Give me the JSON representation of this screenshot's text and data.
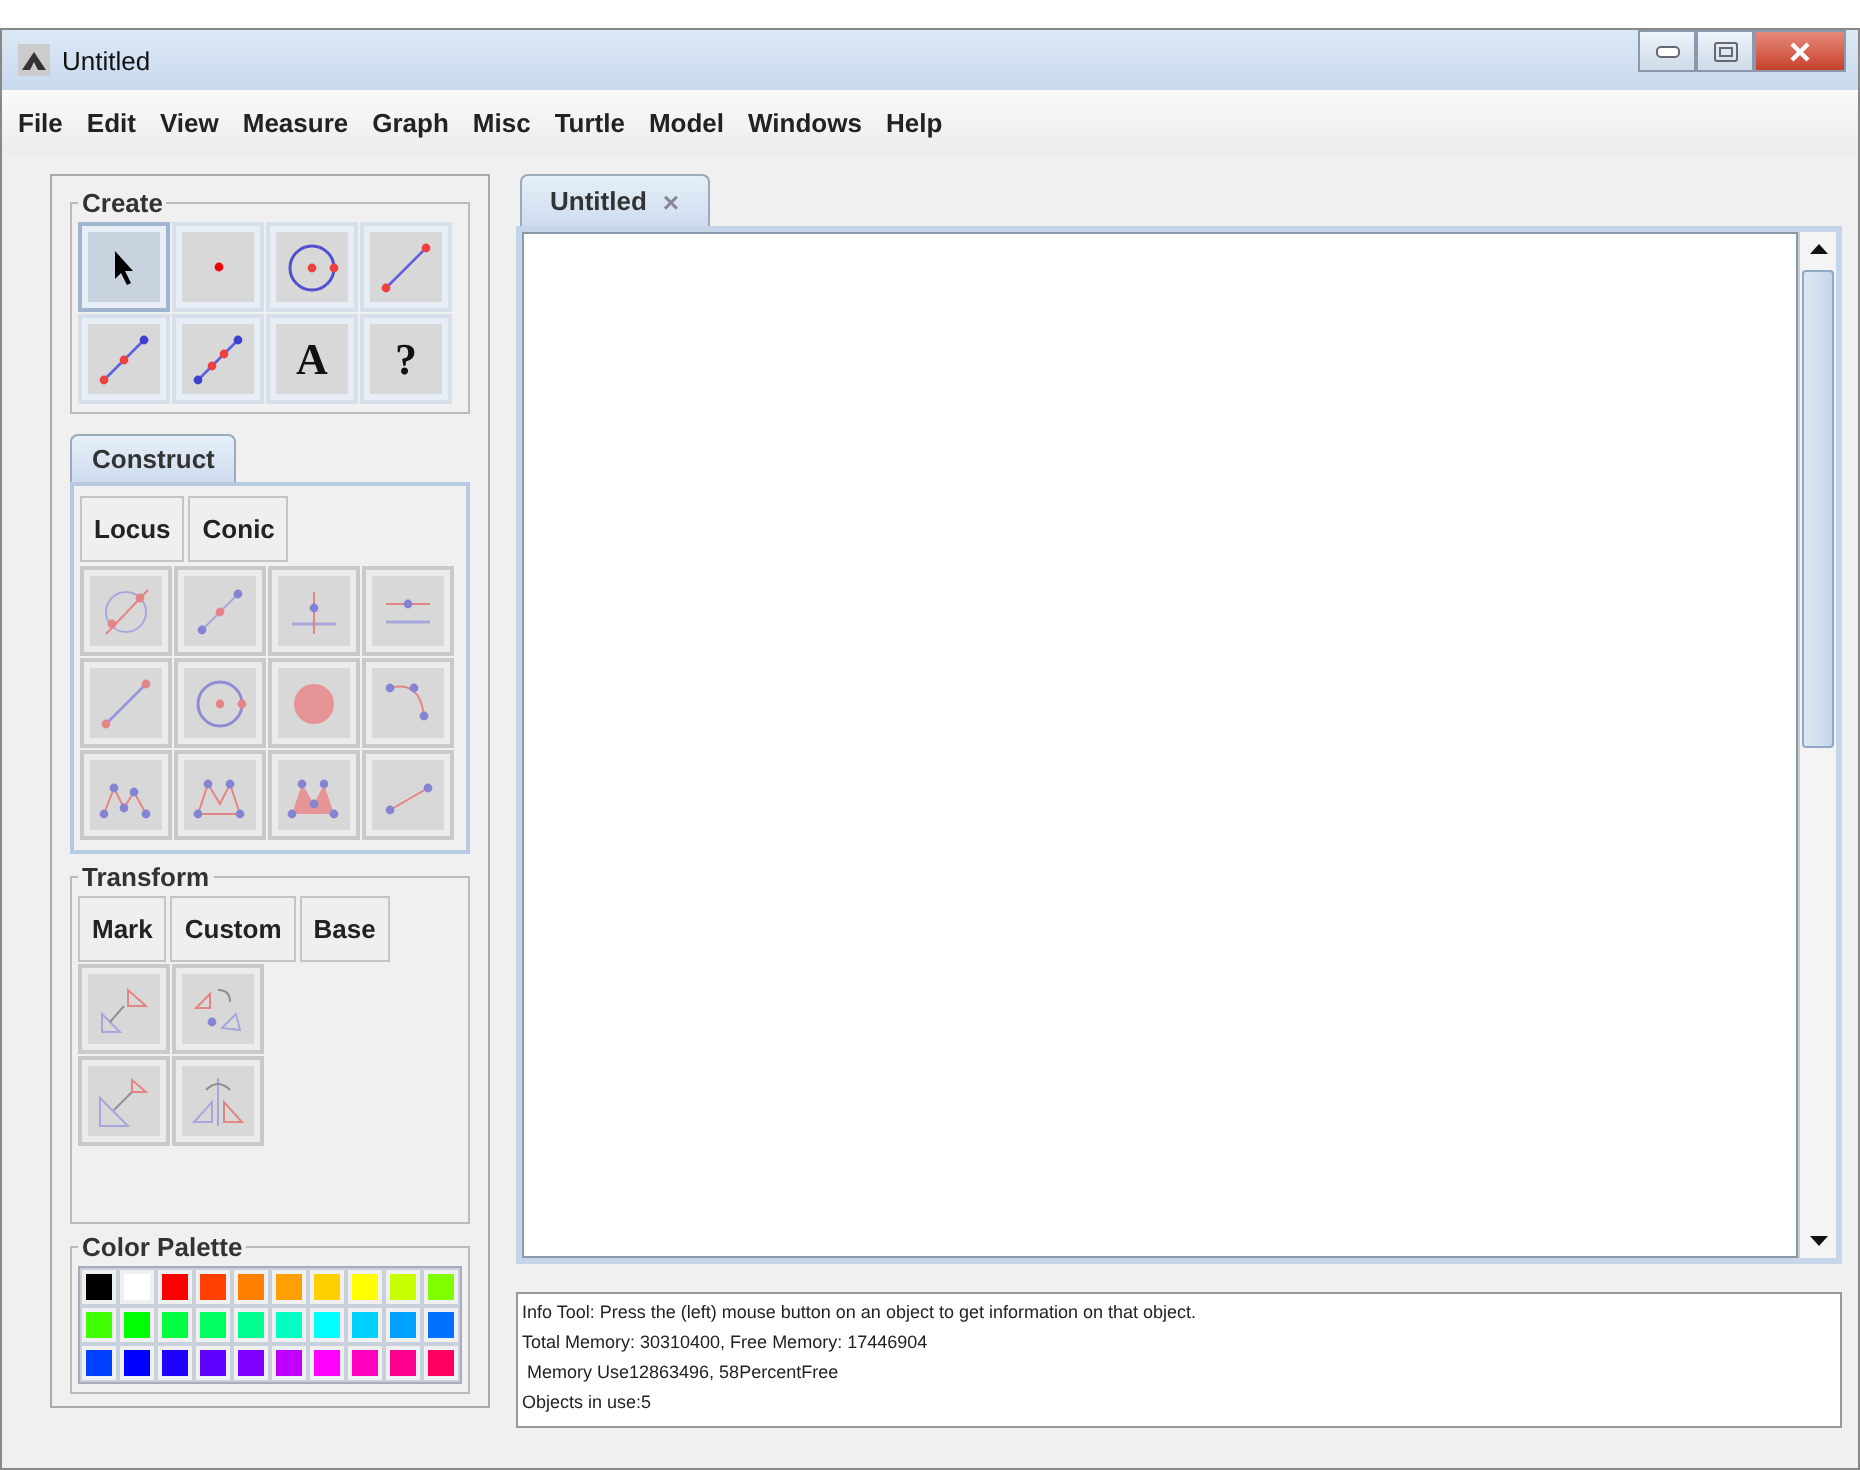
{
  "window": {
    "title": "Untitled"
  },
  "menu": [
    "File",
    "Edit",
    "View",
    "Measure",
    "Graph",
    "Misc",
    "Turtle",
    "Model",
    "Windows",
    "Help"
  ],
  "create": {
    "title": "Create",
    "tools": [
      {
        "kind": "pointer",
        "selected": true
      },
      {
        "kind": "point",
        "selected": false
      },
      {
        "kind": "circle",
        "selected": false
      },
      {
        "kind": "segment",
        "selected": false
      },
      {
        "kind": "line",
        "selected": false
      },
      {
        "kind": "multiline",
        "selected": false
      },
      {
        "kind": "text",
        "label": "A",
        "selected": false
      },
      {
        "kind": "text",
        "label": "?",
        "selected": false
      }
    ]
  },
  "construct": {
    "tab": "Construct",
    "buttons": [
      "Locus",
      "Conic"
    ],
    "tools": [
      {
        "kind": "intersection",
        "disabled": true
      },
      {
        "kind": "midpoint",
        "disabled": true
      },
      {
        "kind": "perpendicular",
        "disabled": true
      },
      {
        "kind": "parallel",
        "disabled": true
      },
      {
        "kind": "segment",
        "disabled": true
      },
      {
        "kind": "circle",
        "disabled": true
      },
      {
        "kind": "disk",
        "disabled": true
      },
      {
        "kind": "arc",
        "disabled": true
      },
      {
        "kind": "polyline",
        "disabled": true
      },
      {
        "kind": "polygon",
        "disabled": true
      },
      {
        "kind": "filled-polygon",
        "disabled": true
      },
      {
        "kind": "ray",
        "disabled": true
      }
    ]
  },
  "transform": {
    "title": "Transform",
    "buttons": [
      "Mark",
      "Custom",
      "Base"
    ],
    "tools": [
      {
        "kind": "translate",
        "disabled": true
      },
      {
        "kind": "rotate",
        "disabled": true
      },
      {
        "kind": "dilate",
        "disabled": true
      },
      {
        "kind": "reflect",
        "disabled": true
      }
    ]
  },
  "palette": {
    "title": "Color Palette",
    "colors": [
      {
        "color": "#000000"
      },
      {
        "color": "#ffffff"
      },
      {
        "color": "#ff0000"
      },
      {
        "color": "#ff4000"
      },
      {
        "color": "#ff8000"
      },
      {
        "color": "#ffa000"
      },
      {
        "color": "#ffd000"
      },
      {
        "color": "#ffff00"
      },
      {
        "color": "#c8ff00"
      },
      {
        "color": "#80ff00"
      },
      {
        "color": "#40ff00"
      },
      {
        "color": "#00ff00"
      },
      {
        "color": "#00ff40"
      },
      {
        "color": "#00ff60"
      },
      {
        "color": "#00ff90"
      },
      {
        "color": "#00ffc0"
      },
      {
        "color": "#00ffff"
      },
      {
        "color": "#00d0ff"
      },
      {
        "color": "#00a0ff"
      },
      {
        "color": "#0070ff"
      },
      {
        "color": "#0040ff"
      },
      {
        "color": "#0000ff"
      },
      {
        "color": "#2000ff"
      },
      {
        "color": "#6000ff"
      },
      {
        "color": "#8000ff"
      },
      {
        "color": "#c000ff"
      },
      {
        "color": "#ff00ff"
      },
      {
        "color": "#ff00c0"
      },
      {
        "color": "#ff0090"
      },
      {
        "color": "#ff0060"
      }
    ]
  },
  "document_tab": {
    "label": "Untitled",
    "close": "×"
  },
  "info": [
    "Info Tool: Press the (left) mouse button on an object to get information on that object.",
    "Total Memory: 30310400, Free Memory: 17446904",
    " Memory Use12863496, 58PercentFree",
    "Objects in use:5"
  ]
}
